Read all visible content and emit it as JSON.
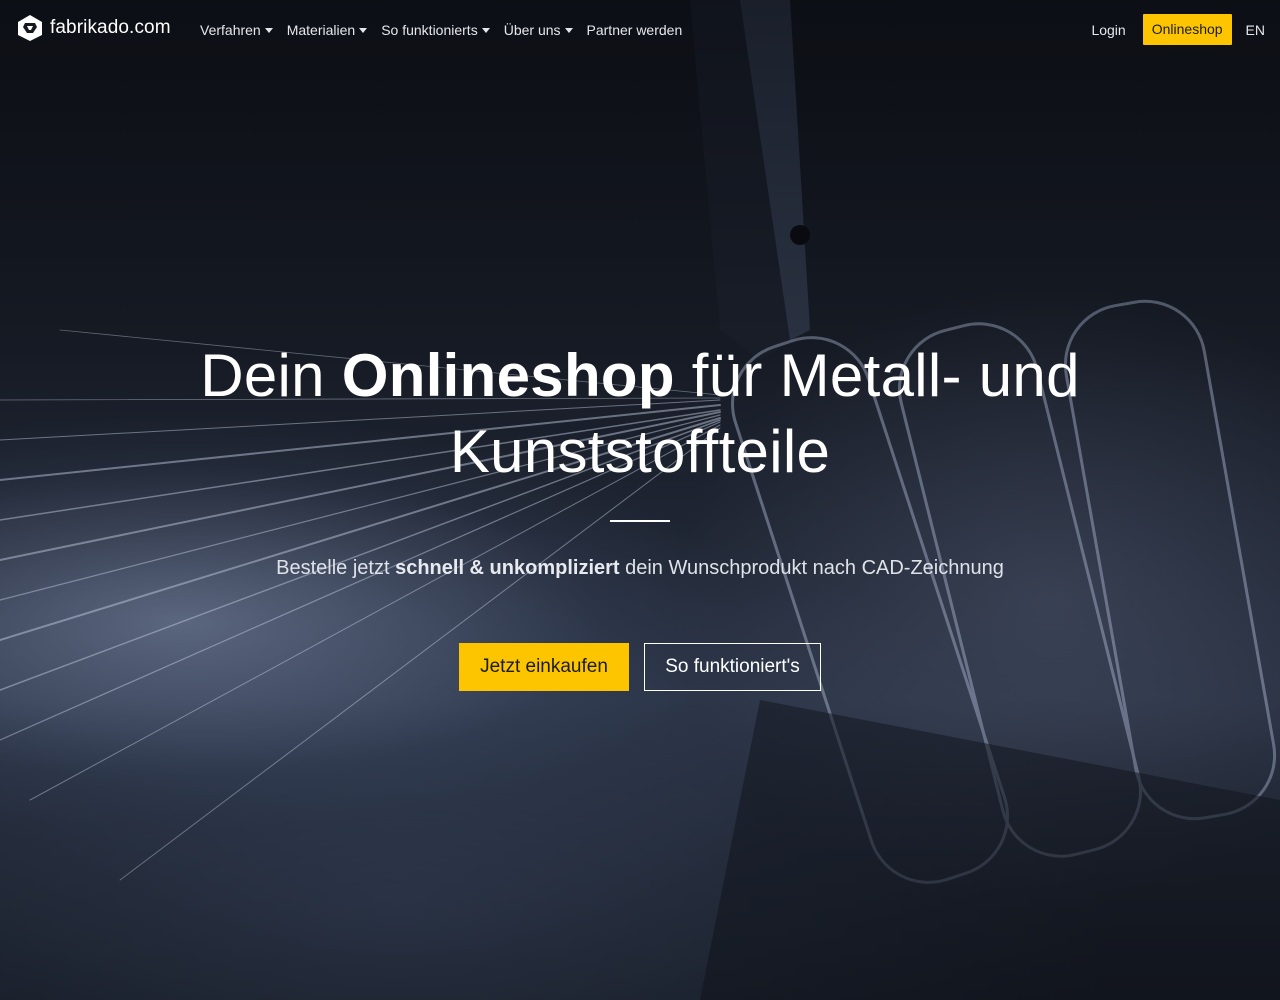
{
  "brand": {
    "name": "fabrikado.com",
    "accent_color": "#fcc500"
  },
  "nav": {
    "items": [
      {
        "label": "Verfahren",
        "has_dropdown": true
      },
      {
        "label": "Materialien",
        "has_dropdown": true
      },
      {
        "label": "So funktionierts",
        "has_dropdown": true
      },
      {
        "label": "Über uns",
        "has_dropdown": true
      },
      {
        "label": "Partner werden",
        "has_dropdown": false
      }
    ],
    "login": "Login",
    "shop": "Onlineshop",
    "language": "EN"
  },
  "hero": {
    "headline_part1": "Dein ",
    "headline_bold": "Onlineshop",
    "headline_part2": " für Metall- und",
    "headline_line2": "Kunststoffteile",
    "sub_part1": "Bestelle jetzt ",
    "sub_bold": "schnell & unkompliziert",
    "sub_part2": " dein Wunschprodukt nach CAD-Zeichnung",
    "cta_primary": "Jetzt einkaufen",
    "cta_secondary": "So funktioniert's"
  }
}
